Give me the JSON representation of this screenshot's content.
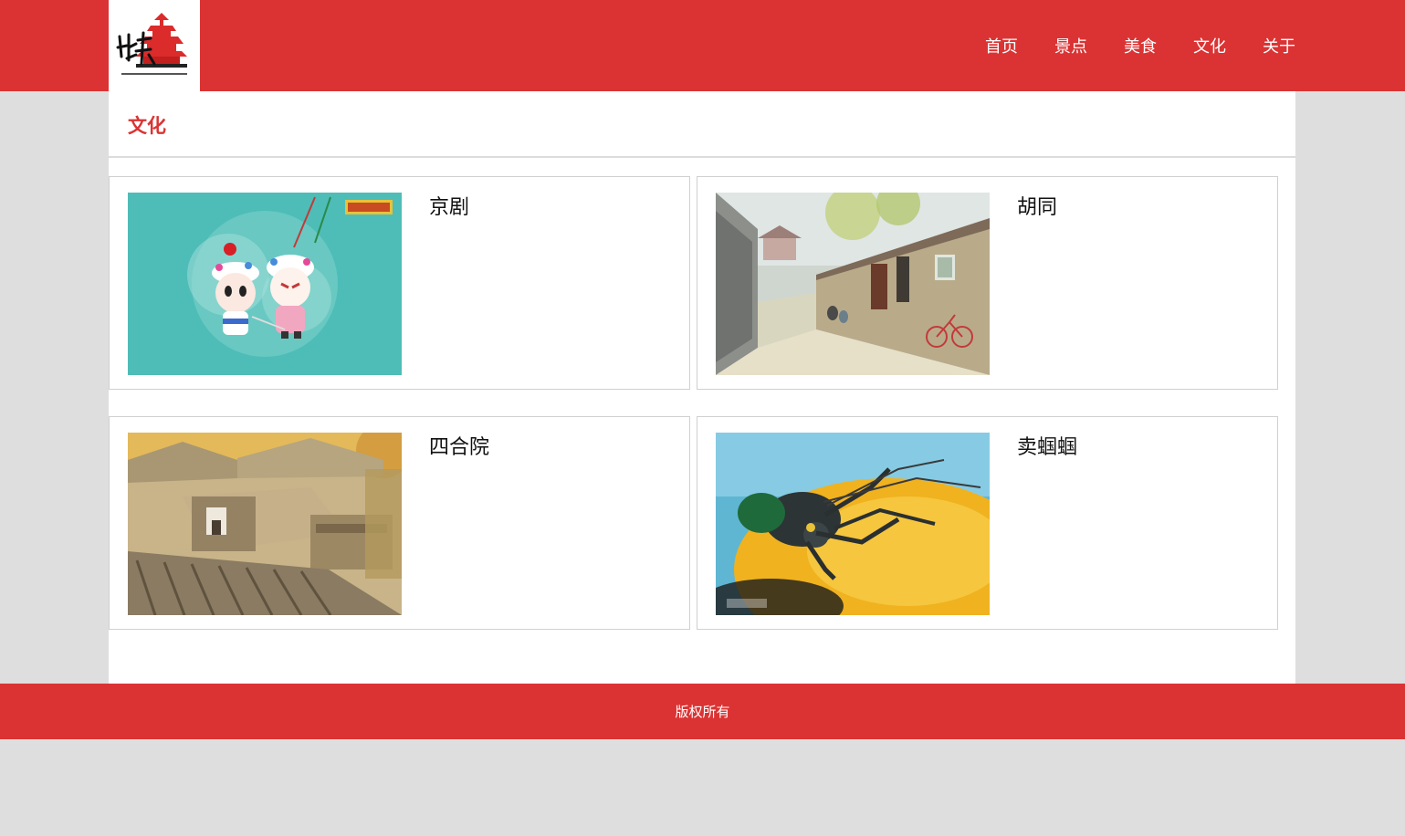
{
  "header": {
    "logo_icon": "beijing-temple-logo",
    "nav": [
      {
        "label": "首页"
      },
      {
        "label": "景点"
      },
      {
        "label": "美食"
      },
      {
        "label": "文化"
      },
      {
        "label": "关于"
      }
    ]
  },
  "section": {
    "title": "文化"
  },
  "cards": [
    {
      "title": "京剧",
      "image": "peking-opera-illustration"
    },
    {
      "title": "胡同",
      "image": "hutong-alley-painting"
    },
    {
      "title": "四合院",
      "image": "siheyuan-courtyard-photo"
    },
    {
      "title": "卖蝈蝈",
      "image": "katydid-on-gourd-photo"
    }
  ],
  "footer": {
    "text": "版权所有"
  },
  "colors": {
    "brand_red": "#db3333",
    "page_bg": "#dedede",
    "panel_bg": "#ffffff"
  }
}
